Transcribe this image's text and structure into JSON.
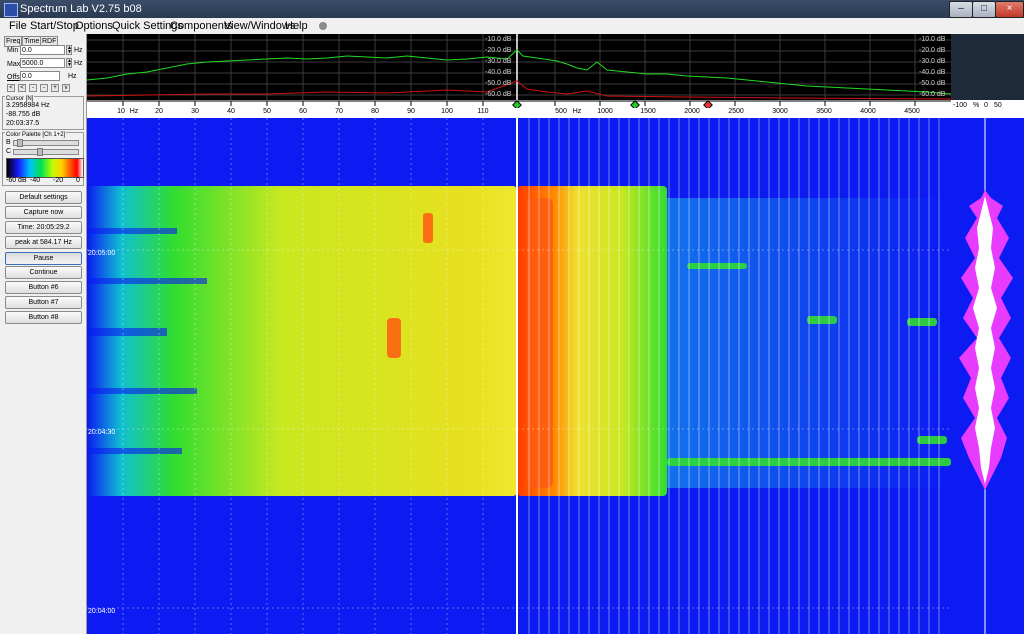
{
  "window": {
    "title": "Spectrum Lab V2.75 b08",
    "controls": {
      "minimize": "–",
      "maximize": "□",
      "close": "×"
    }
  },
  "menu": {
    "file": "File",
    "start_stop": "Start/Stop",
    "options": "Options",
    "quick_settings": "Quick Settings",
    "components": "Components",
    "view_windows": "View/Windows",
    "help": "Help"
  },
  "left_panel": {
    "tabs": {
      "freq": "Freq",
      "time": "Time",
      "rdf": "RDF"
    },
    "min_label": "Min",
    "min_value": "0.0",
    "max_label": "Max",
    "max_value": "5000.0",
    "offs_label": "Offs",
    "offs_value": "0.0",
    "unit_hz": "Hz",
    "nav_buttons": [
      "<",
      "<",
      "-",
      "-",
      "+",
      "v"
    ],
    "cursor_group": "Cursor [N]",
    "cursor_freq": "3.2958984 Hz",
    "cursor_level": "-88.755 dB",
    "cursor_time": "20:03:37.5",
    "palette_group": "Color Palette [Ch 1+2]",
    "b_label": "B",
    "c_label": "C",
    "b_level": 0.05,
    "c_level": 0.4,
    "palette_ticks": [
      "-60 dB",
      "-40",
      "-20",
      "0"
    ],
    "buttons": [
      {
        "label": "Default settings"
      },
      {
        "label": "Capture now"
      },
      {
        "label": "Time:  20:05:29.2"
      },
      {
        "label": "peak at 584.17 Hz"
      },
      {
        "label": "Pause"
      },
      {
        "label": "Continue"
      },
      {
        "label": "Button #6"
      },
      {
        "label": "Button #7"
      },
      {
        "label": "Button #8"
      }
    ]
  },
  "spectrum": {
    "db_labels": [
      "-10.0 dB",
      "-20.0 dB",
      "-30.0 dB",
      "-40.0 dB",
      "-50.0 dB",
      "-60.0 dB"
    ],
    "db_labels_right": [
      "-10.0 dB",
      "-20.0 dB",
      "-30.0 dB",
      "-40.0 dB",
      "-50.0 dB",
      "-60.0 dB"
    ]
  },
  "freq_axis": {
    "ticks": [
      "10",
      "Hz",
      "20",
      "30",
      "40",
      "50",
      "60",
      "70",
      "80",
      "90",
      "100",
      "110",
      "500",
      "Hz",
      "1000",
      "1500",
      "2000",
      "2500",
      "3000",
      "3500",
      "4000",
      "4500"
    ]
  },
  "waterfall": {
    "time_labels": [
      "20:05:00",
      "20:04:30",
      "20:04:00"
    ]
  },
  "scope": {
    "header": {
      "a": "-100",
      "b": "%",
      "c": "0",
      "d": "50"
    }
  },
  "colors": {
    "waterfall_bg": "#0b1bf2",
    "spectrum_green": "#22dd22",
    "spectrum_red": "#d01010",
    "cursor_line": "#ffffff"
  }
}
